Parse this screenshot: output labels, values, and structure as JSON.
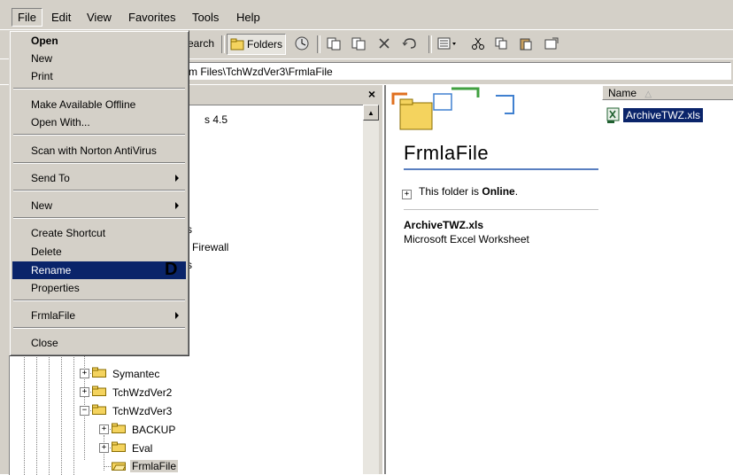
{
  "menubar": {
    "items": [
      "File",
      "Edit",
      "View",
      "Favorites",
      "Tools",
      "Help"
    ]
  },
  "toolbar": {
    "search_label": "earch",
    "folders_label": "Folders"
  },
  "address": {
    "value": "m Files\\TchWzdVer3\\FrmlaFile"
  },
  "folder_pane": {
    "close_glyph": "×",
    "partial_labels": [
      "s 4.5",
      "s",
      "l Firewall",
      "s"
    ],
    "tree_items": [
      "Symantec",
      "TchWzdVer2",
      "TchWzdVer3",
      "BACKUP",
      "Eval",
      "FrmlaFile"
    ],
    "toggles": [
      "+",
      "+",
      "−",
      "+",
      "+"
    ]
  },
  "file_menu": {
    "items": [
      {
        "label": "Open"
      },
      {
        "label": "New"
      },
      {
        "label": "Print"
      },
      {
        "label": "Make Available Offline"
      },
      {
        "label": "Open With..."
      },
      {
        "label": "Scan with Norton AntiVirus"
      },
      {
        "label": "Send To"
      },
      {
        "label": "New"
      },
      {
        "label": "Create Shortcut"
      },
      {
        "label": "Delete"
      },
      {
        "label": "Rename"
      },
      {
        "label": "Properties"
      },
      {
        "label": "FrmlaFile"
      },
      {
        "label": "Close"
      }
    ]
  },
  "annotation": {
    "label": "D"
  },
  "right_pane": {
    "folder_title": "FrmlaFile",
    "online_prefix": "This folder is ",
    "online_status": "Online",
    "online_suffix": ".",
    "expand_glyph": "+",
    "selected_file_name": "ArchiveTWZ.xls",
    "selected_file_type": "Microsoft Excel Worksheet",
    "column_name": "Name",
    "sort_glyph": "△",
    "file_label": "ArchiveTWZ.xls"
  },
  "colors": {
    "chrome": "#d4d0c8",
    "highlight": "#0a246a",
    "folder_yellow": "#f4d35e"
  }
}
